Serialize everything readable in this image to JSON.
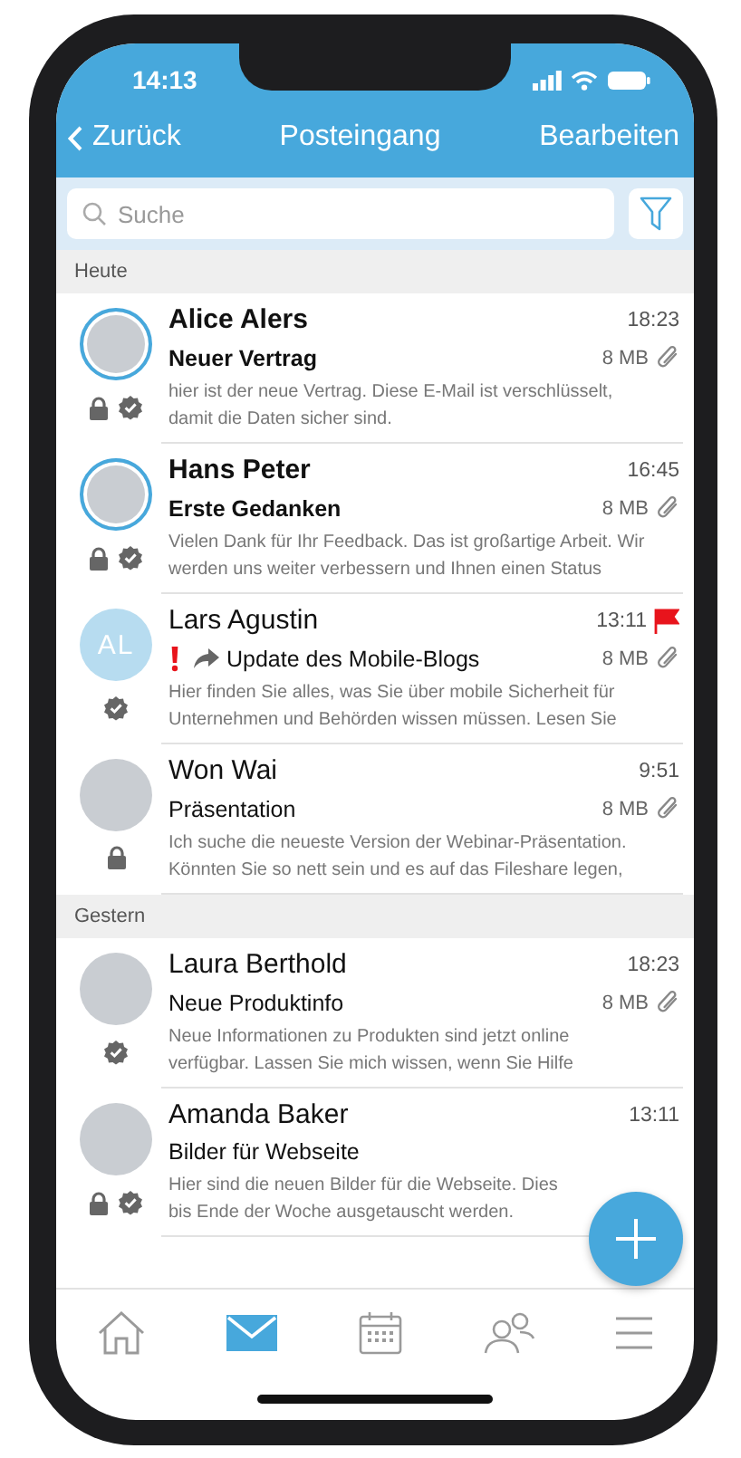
{
  "status_bar": {
    "time": "14:13"
  },
  "nav": {
    "back": "Zurück",
    "title": "Posteingang",
    "action": "Bearbeiten"
  },
  "search": {
    "placeholder": "Suche"
  },
  "sections": [
    {
      "label": "Heute",
      "messages": [
        {
          "sender": "Alice Alers",
          "kind": "photo",
          "ring": true,
          "time": "18:23",
          "flagged": false,
          "important": false,
          "forwarded": false,
          "unread": true,
          "subject": "Neuer Vertrag",
          "size": "8 MB",
          "attachment": true,
          "encrypted": true,
          "signed": true,
          "preview_lines": [
            "hier ist der neue Vertrag. Diese E-Mail ist verschlüsselt,",
            "damit die Daten sicher sind."
          ]
        },
        {
          "sender": "Hans Peter",
          "kind": "photo",
          "ring": true,
          "time": "16:45",
          "flagged": false,
          "important": false,
          "forwarded": false,
          "unread": true,
          "subject": "Erste Gedanken",
          "size": "8 MB",
          "attachment": true,
          "encrypted": true,
          "signed": true,
          "preview_lines": [
            "Vielen Dank für Ihr Feedback. Das ist großartige Arbeit. Wir",
            "werden uns weiter verbessern und Ihnen einen Status"
          ]
        },
        {
          "sender": "Lars Agustin",
          "kind": "initials",
          "initials": "AL",
          "ring": false,
          "time": "13:11",
          "flagged": true,
          "important": true,
          "forwarded": true,
          "unread": false,
          "subject": "Update des Mobile-Blogs",
          "size": "8 MB",
          "attachment": true,
          "encrypted": false,
          "signed": true,
          "preview_lines": [
            "Hier finden Sie alles, was Sie über mobile Sicherheit für",
            "Unternehmen und Behörden wissen müssen. Lesen Sie"
          ]
        },
        {
          "sender": "Won Wai",
          "kind": "photo",
          "ring": false,
          "time": "9:51",
          "flagged": false,
          "important": false,
          "forwarded": false,
          "unread": false,
          "subject": "Präsentation",
          "size": "8 MB",
          "attachment": true,
          "encrypted": true,
          "signed": false,
          "preview_lines": [
            "Ich suche die neueste Version der Webinar-Präsentation.",
            "Könnten Sie so nett sein und es auf das Fileshare legen,"
          ]
        }
      ]
    },
    {
      "label": "Gestern",
      "messages": [
        {
          "sender": "Laura Berthold",
          "kind": "photo",
          "ring": false,
          "time": "18:23",
          "flagged": false,
          "important": false,
          "forwarded": false,
          "unread": false,
          "subject": "Neue Produktinfo",
          "size": "8 MB",
          "attachment": true,
          "encrypted": false,
          "signed": true,
          "preview_lines": [
            "Neue Informationen zu Produkten sind jetzt online",
            "verfügbar. Lassen Sie mich wissen, wenn Sie Hilfe"
          ]
        },
        {
          "sender": "Amanda Baker",
          "kind": "photo",
          "ring": false,
          "time": "13:11",
          "flagged": false,
          "important": false,
          "forwarded": false,
          "unread": false,
          "subject": "Bilder für Webseite",
          "encrypted": true,
          "signed": true,
          "preview_lines": [
            "Hier sind die neuen Bilder für die Webseite. Dies",
            "bis Ende der Woche ausgetauscht werden."
          ]
        }
      ]
    }
  ],
  "tab_bar": [
    {
      "kind": "home",
      "selected": false
    },
    {
      "kind": "mail",
      "selected": true
    },
    {
      "kind": "calendar",
      "selected": false
    },
    {
      "kind": "contacts",
      "selected": false
    },
    {
      "kind": "menu",
      "selected": false
    }
  ]
}
